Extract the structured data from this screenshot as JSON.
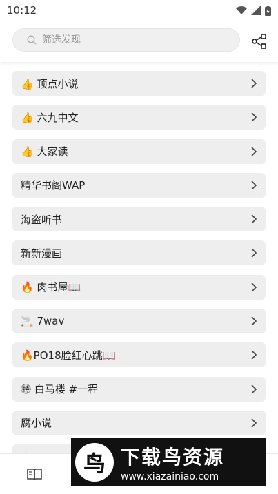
{
  "status_bar": {
    "time": "10:12"
  },
  "search": {
    "placeholder": "筛选发现",
    "value": ""
  },
  "sources": [
    {
      "label": "👍 顶点小说"
    },
    {
      "label": "👍 六九中文"
    },
    {
      "label": "👍 大家读"
    },
    {
      "label": "精华书阁WAP"
    },
    {
      "label": "海盗听书"
    },
    {
      "label": "新新漫画"
    },
    {
      "label": "🔥 肉书屋📖"
    },
    {
      "label": "🚬 7wav"
    },
    {
      "label": "🔥PO18脸红心跳📖"
    },
    {
      "label": "㊕ 白马楼 #一程"
    },
    {
      "label": "腐小说"
    },
    {
      "label": "小雪正"
    }
  ],
  "watermark": {
    "logo": "鸟",
    "title": "下载鸟资源",
    "url": "www.xiazainiao.com"
  }
}
